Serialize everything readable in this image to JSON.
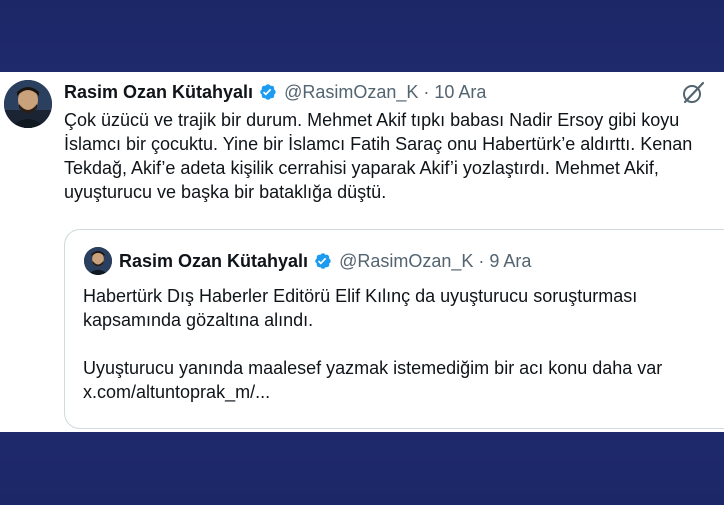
{
  "tweet": {
    "author_name": "Rasim Ozan Kütahyalı",
    "handle": "@RasimOzan_K",
    "separator": "·",
    "date": "10 Ara",
    "text": "Çok üzücü ve trajik bir durum. Mehmet Akif tıpkı babası Nadir Ersoy gibi koyu İslamcı bir çocuktu. Yine bir İslamcı Fatih Saraç onu Habertürk’e aldırttı. Kenan Tekdağ, Akif’e adeta kişilik cerrahisi yaparak Akif’i yozlaştırdı. Mehmet Akif, uyuşturucu ve başka bir bataklığa düştü."
  },
  "quoted_tweet": {
    "author_name": "Rasim Ozan Kütahyalı",
    "handle": "@RasimOzan_K",
    "separator": "·",
    "date": "9 Ara",
    "paragraph_1": "Habertürk Dış Haberler Editörü Elif Kılınç da uyuşturucu soruşturması kapsamında gözaltına alındı.",
    "paragraph_2": "Uyuşturucu yanında maalesef yazmak istemediğim bir acı konu daha var x.com/altuntoprak_m/..."
  },
  "icons": {
    "verified": "verified-badge-icon",
    "grok": "grok-icon"
  },
  "colors": {
    "background": "#1f2a6e",
    "card": "#ffffff",
    "text": "#0f1419",
    "muted": "#536471",
    "verified": "#1d9bf0",
    "border": "#cfd9de"
  }
}
